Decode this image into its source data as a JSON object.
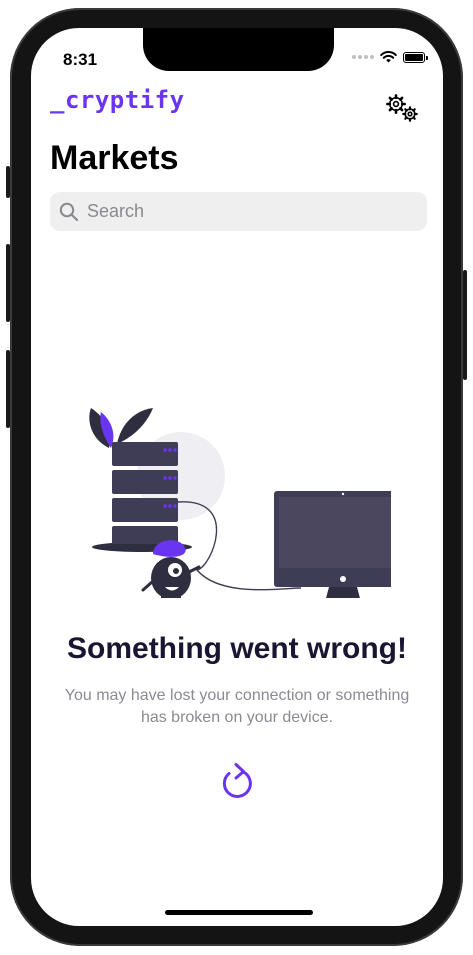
{
  "status_bar": {
    "time": "8:31"
  },
  "header": {
    "logo": "_cryptify",
    "title": "Markets"
  },
  "search": {
    "placeholder": "Search"
  },
  "error": {
    "title": "Something went wrong!",
    "message": "You may have lost your connection or something has broken on your device."
  },
  "colors": {
    "accent": "#6a35f0",
    "title_text": "#1a1530",
    "muted_text": "#8a8a94",
    "dark_fill": "#3f3d56"
  },
  "icons": {
    "settings": "gears-icon",
    "search": "magnifier-icon",
    "retry": "refresh-arrow-icon",
    "wifi": "wifi-icon",
    "battery": "battery-icon"
  },
  "battery_level": 1.0
}
